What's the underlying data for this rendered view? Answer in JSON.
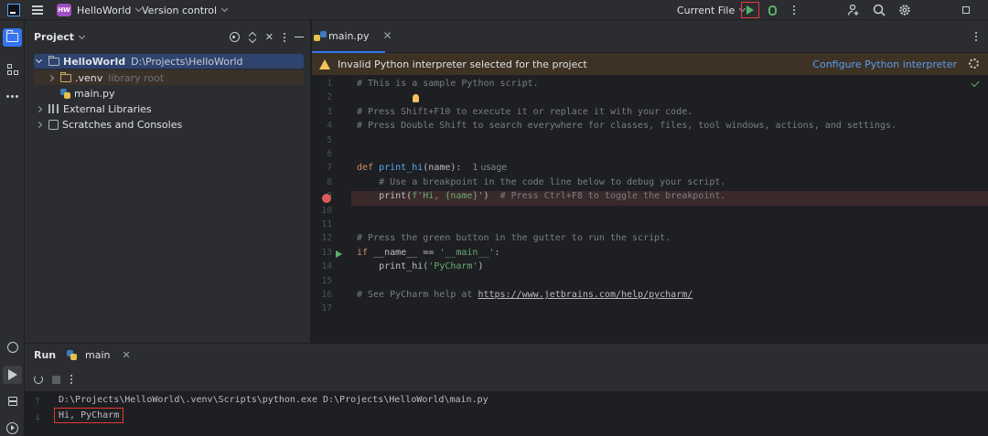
{
  "titlebar": {
    "project_badge": "HW",
    "project_name": "HelloWorld",
    "vcs": "Version control",
    "run_config": "Current File"
  },
  "project_panel": {
    "title": "Project",
    "tree": [
      {
        "name": "HelloWorld",
        "extra": "D:\\Projects\\HelloWorld"
      },
      {
        "name": ".venv",
        "extra": "library root"
      },
      {
        "name": "main.py",
        "extra": ""
      },
      {
        "name": "External Libraries",
        "extra": ""
      },
      {
        "name": "Scratches and Consoles",
        "extra": ""
      }
    ]
  },
  "editor": {
    "tab": "main.py",
    "warning": "Invalid Python interpreter selected for the project",
    "warning_action": "Configure Python interpreter",
    "line_numbers": [
      "1",
      "2",
      "3",
      "4",
      "5",
      "6",
      "7",
      "8",
      "9",
      "10",
      "11",
      "12",
      "13",
      "14",
      "15",
      "16",
      "17"
    ],
    "code": {
      "l1": "# This is a sample Python script.",
      "l3": "# Press Shift+F10 to execute it or replace it with your code.",
      "l4": "# Press Double Shift to search everywhere for classes, files, tool windows, actions, and settings.",
      "l7_kw": "def ",
      "l7_fn": "print_hi",
      "l7_rest": "(name):",
      "l7_usage": "1 usage",
      "l8": "    # Use a breakpoint in the code line below to debug your script.",
      "l9_a": "    print(",
      "l9_str": "f'Hi, {name}'",
      "l9_b": ")  ",
      "l9_com": "# Press Ctrl+F8 to toggle the breakpoint.",
      "l12": "# Press the green button in the gutter to run the script.",
      "l13_kw": "if ",
      "l13_a": "__name__ == ",
      "l13_str": "'__main__'",
      "l13_b": ":",
      "l14_a": "    print_hi(",
      "l14_str": "'PyCharm'",
      "l14_b": ")",
      "l16_com": "# See PyCharm help at ",
      "l16_link": "https://www.jetbrains.com/help/pycharm/"
    }
  },
  "run_panel": {
    "title": "Run",
    "tab": "main",
    "output": [
      "D:\\Projects\\HelloWorld\\.venv\\Scripts\\python.exe D:\\Projects\\HelloWorld\\main.py",
      "Hi, PyCharm"
    ]
  },
  "colors": {
    "accent": "#3574f0",
    "run_green": "#57b366",
    "highlight_red": "#e53935",
    "breakpoint": "#db5c5c",
    "warning_bg": "#3d3223"
  }
}
